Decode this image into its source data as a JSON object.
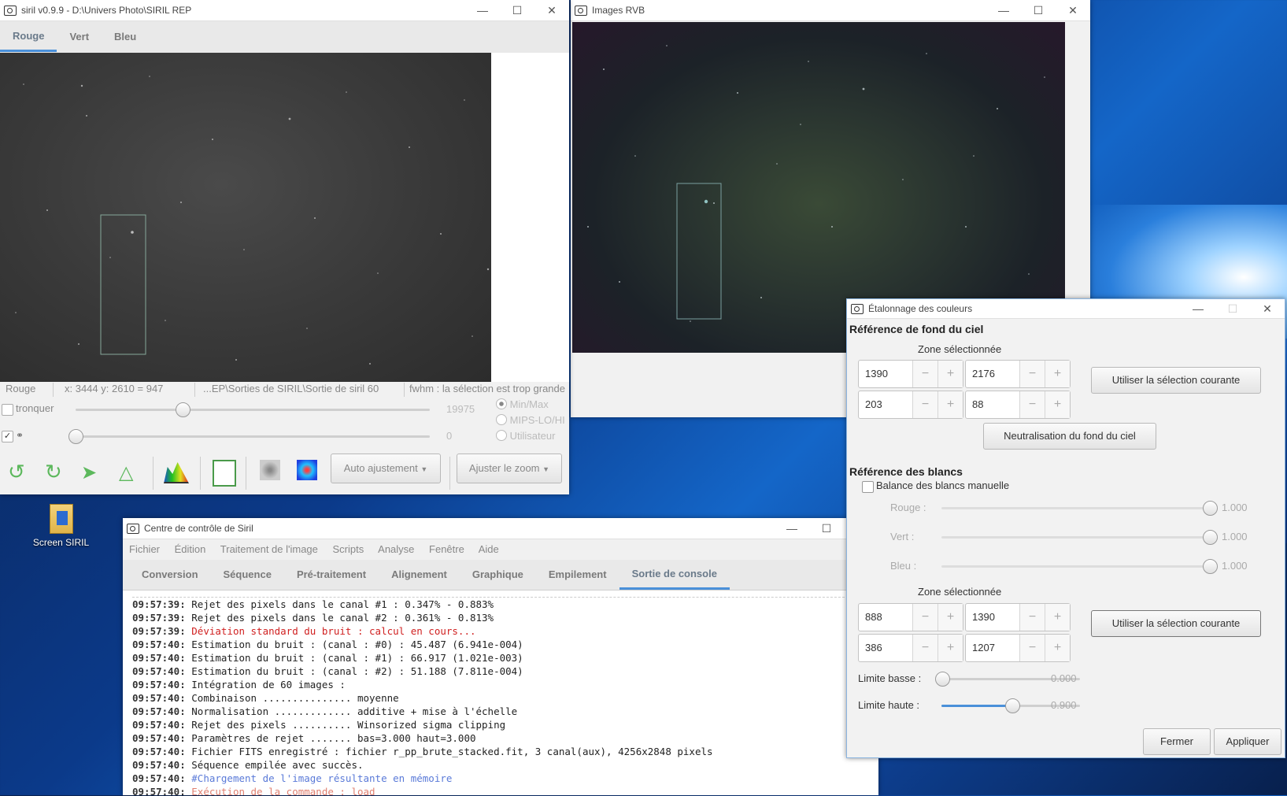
{
  "desktop": {
    "icon_label": "Screen SIRIL"
  },
  "main_window": {
    "title": "siril v0.9.9 - D:\\Univers Photo\\SIRIL REP",
    "tabs": [
      "Rouge",
      "Vert",
      "Bleu"
    ],
    "status": {
      "channel": "Rouge",
      "coords": "x: 3444 y: 2610 = 947",
      "path": "...EP\\Sorties de SIRIL\\Sortie de siril 60",
      "fwhm": "fwhm : la sélection est trop grande"
    },
    "tronquer_label": "tronquer",
    "hi_value": "19975",
    "lo_value": "0",
    "radios": [
      "Min/Max",
      "MIPS-LO/HI",
      "Utilisateur"
    ],
    "auto_adjust": "Auto ajustement",
    "zoom_fit": "Ajuster le zoom"
  },
  "rgb_window": {
    "title": "Images RVB"
  },
  "control_window": {
    "title": "Centre de contrôle de Siril",
    "menu": [
      "Fichier",
      "Édition",
      "Traitement de l'image",
      "Scripts",
      "Analyse",
      "Fenêtre",
      "Aide"
    ],
    "tabs": [
      "Conversion",
      "Séquence",
      "Pré-traitement",
      "Alignement",
      "Graphique",
      "Empilement",
      "Sortie de console"
    ],
    "console": [
      {
        "t": "09:57:39:",
        "m": "Rejet des pixels dans le canal #1 : 0.347% - 0.883%",
        "c": "normal"
      },
      {
        "t": "09:57:39:",
        "m": "Rejet des pixels dans le canal #2 : 0.361% - 0.813%",
        "c": "normal"
      },
      {
        "t": "09:57:39:",
        "m": "Déviation standard du bruit : calcul en cours...",
        "c": "red"
      },
      {
        "t": "09:57:40:",
        "m": "Estimation du bruit : (canal : #0) : 45.487 (6.941e-004)",
        "c": "normal"
      },
      {
        "t": "09:57:40:",
        "m": "Estimation du bruit : (canal : #1) : 66.917 (1.021e-003)",
        "c": "normal"
      },
      {
        "t": "09:57:40:",
        "m": "Estimation du bruit : (canal : #2) : 51.188 (7.811e-004)",
        "c": "normal"
      },
      {
        "t": "09:57:40:",
        "m": "Intégration de 60 images :",
        "c": "normal"
      },
      {
        "t": "09:57:40:",
        "m": "Combinaison ............... moyenne",
        "c": "normal"
      },
      {
        "t": "09:57:40:",
        "m": "Normalisation ............. additive + mise à l'échelle",
        "c": "normal"
      },
      {
        "t": "09:57:40:",
        "m": "Rejet des pixels .......... Winsorized sigma clipping",
        "c": "normal"
      },
      {
        "t": "09:57:40:",
        "m": "Paramètres de rejet ....... bas=3.000 haut=3.000",
        "c": "normal"
      },
      {
        "t": "09:57:40:",
        "m": "Fichier FITS enregistré : fichier r_pp_brute_stacked.fit, 3 canal(aux), 4256x2848 pixels",
        "c": "normal"
      },
      {
        "t": "09:57:40:",
        "m": "Séquence empilée avec succès.",
        "c": "normal"
      },
      {
        "t": "09:57:40:",
        "m": "#Chargement de l'image résultante en mémoire",
        "c": "blue"
      },
      {
        "t": "09:57:40:",
        "m": "Exécution de la commande : load",
        "c": "salmon"
      }
    ]
  },
  "calib_dialog": {
    "title": "Étalonnage des couleurs",
    "bg_section": "Référence de fond du ciel",
    "zone_label": "Zone sélectionnée",
    "bg_zone": [
      "1390",
      "2176",
      "203",
      "88"
    ],
    "use_selection": "Utiliser la sélection courante",
    "neutralize": "Neutralisation du fond du ciel",
    "white_section": "Référence des blancs",
    "manual_wb": "Balance des blancs manuelle",
    "rouge_label": "Rouge :",
    "rouge_value": "1.000",
    "vert_label": "Vert :",
    "vert_value": "1.000",
    "bleu_label": "Bleu :",
    "bleu_value": "1.000",
    "white_zone": [
      "888",
      "1390",
      "386",
      "1207"
    ],
    "low_label": "Limite basse :",
    "low_value": "0.000",
    "high_label": "Limite haute :",
    "high_value": "0.900",
    "close": "Fermer",
    "apply": "Appliquer"
  }
}
